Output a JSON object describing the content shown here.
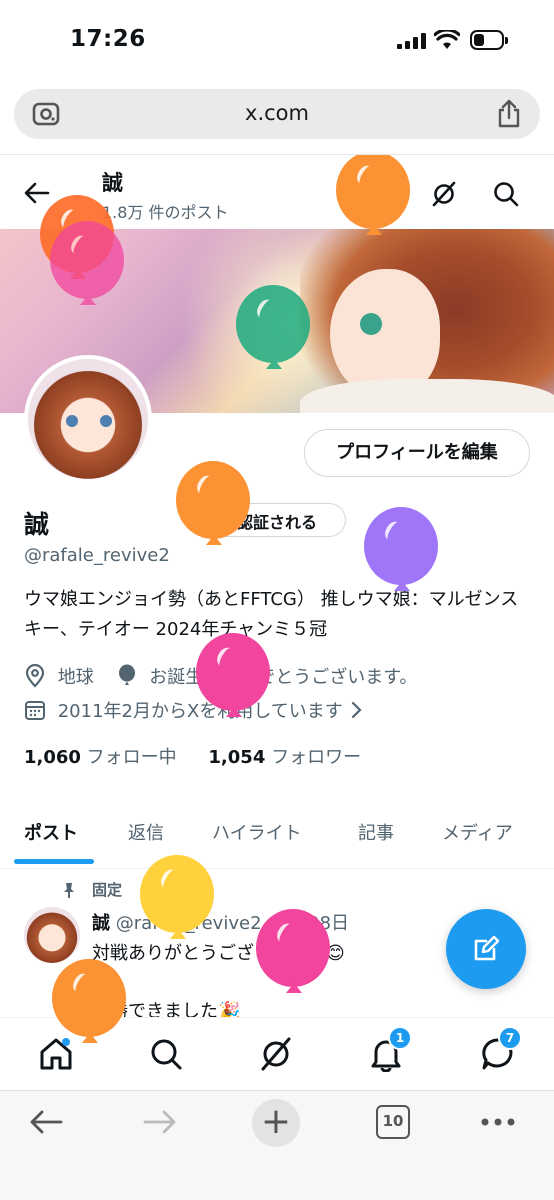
{
  "status_bar": {
    "time": "17:26"
  },
  "browser": {
    "url": "x.com",
    "tab_count": "10"
  },
  "header": {
    "name": "誠",
    "post_count": "1.8万 件のポスト"
  },
  "profile": {
    "name": "誠",
    "verified_label": "認証される",
    "handle": "@rafale_revive2",
    "bio": "ウマ娘エンジョイ勢（あとFFTCG） 推しウマ娘：マルゼンスキー、テイオー 2024年チャンミ５冠",
    "location": "地球",
    "birthday": "お誕生日おめでとうございます。",
    "joined": "2011年2月からXを利用しています",
    "edit_label": "プロフィールを編集",
    "following_count": "1,060",
    "following_label": "フォロー中",
    "followers_count": "1,054",
    "followers_label": "フォロワー"
  },
  "tabs": [
    {
      "label": "ポスト",
      "active": true
    },
    {
      "label": "返信"
    },
    {
      "label": "ハイライト"
    },
    {
      "label": "記事"
    },
    {
      "label": "メディア"
    }
  ],
  "post": {
    "pinned_label": "固定",
    "author": "誠",
    "handle_date": "@rafale_revive2 · 6月28日",
    "line1": "対戦ありがとうございました😊",
    "line2": "優勝できました🎉"
  },
  "bottom_nav": {
    "notifications_badge": "1",
    "messages_badge": "7"
  },
  "colors": {
    "accent": "#1d9bf0",
    "text": "#0f1419",
    "muted": "#536471"
  },
  "balloon_colors": [
    "#fe6d2b",
    "#f1459e",
    "#1dab7f",
    "#fb9234",
    "#a076f9",
    "#ffd13c"
  ]
}
